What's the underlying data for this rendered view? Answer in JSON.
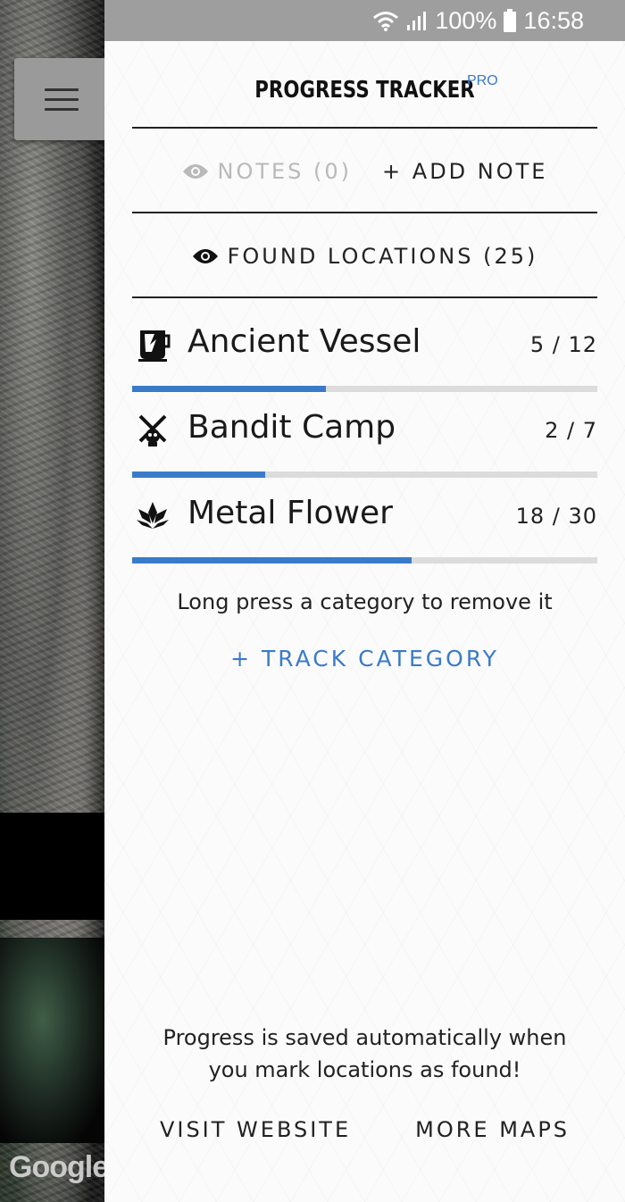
{
  "status_bar": {
    "battery": "100%",
    "time": "16:58",
    "icons": [
      "wifi-icon",
      "signal-icon",
      "battery-icon"
    ]
  },
  "map": {
    "menu_icon": "hamburger-menu-icon",
    "logo_text": "Google"
  },
  "drawer": {
    "title": "PROGRESS TRACKER",
    "badge": "PRO",
    "notes_label": "NOTES (0)",
    "add_note_label": "+ ADD NOTE",
    "found_locations_label": "FOUND LOCATIONS (25)",
    "categories": [
      {
        "name": "Ancient Vessel",
        "count": "5 / 12",
        "found": 5,
        "total": 12,
        "icon": "vessel-icon"
      },
      {
        "name": "Bandit Camp",
        "count": "2 / 7",
        "found": 2,
        "total": 7,
        "icon": "bandit-camp-icon"
      },
      {
        "name": "Metal Flower",
        "count": "18 / 30",
        "found": 18,
        "total": 30,
        "icon": "metal-flower-icon"
      }
    ],
    "hint": "Long press a category to remove it",
    "track_category_label": "+ TRACK CATEGORY",
    "saved_line1": "Progress is saved automatically when",
    "saved_line2": "you mark locations as found!",
    "visit_website_label": "VISIT WEBSITE",
    "more_maps_label": "MORE MAPS"
  },
  "colors": {
    "accent": "#3a7bc8",
    "status_bar": "#9e9e9e",
    "disabled_text": "#b9b9b9"
  }
}
